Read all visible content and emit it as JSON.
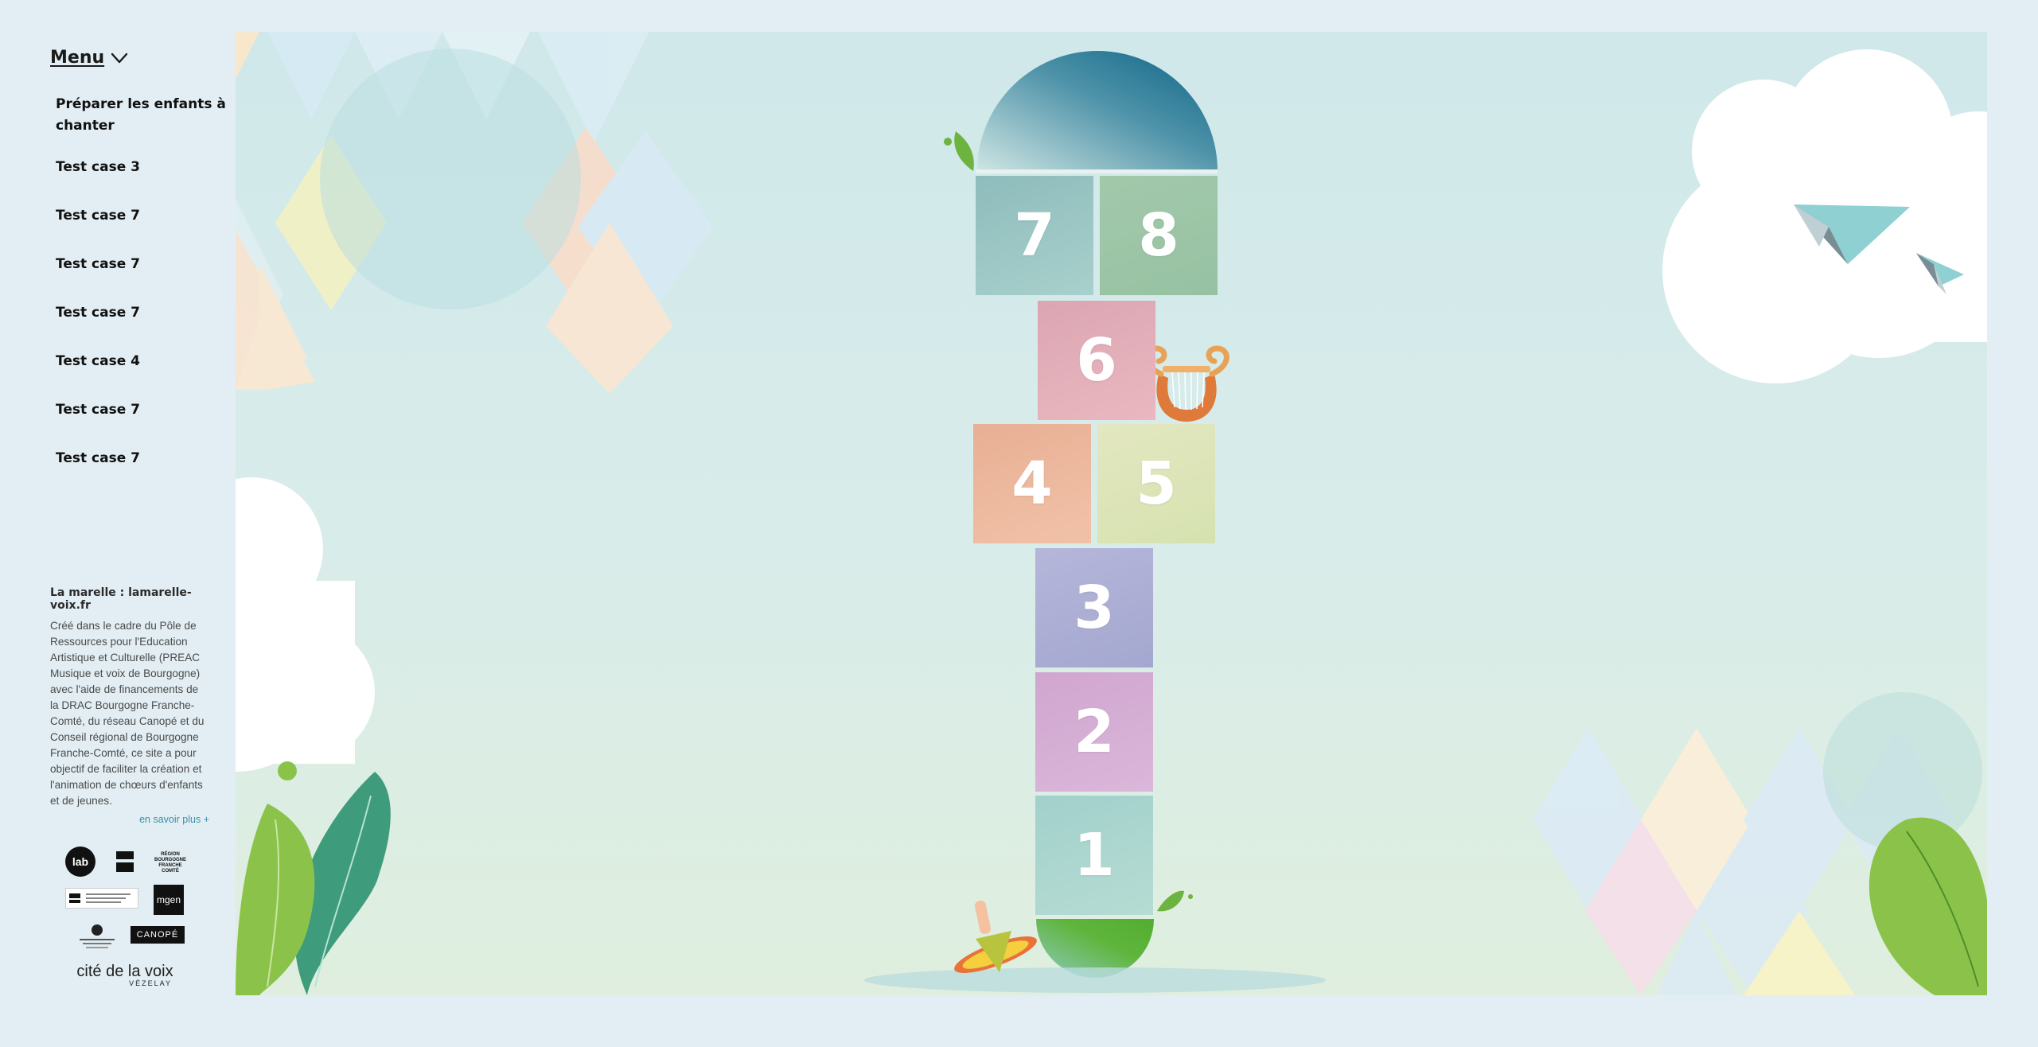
{
  "menu": {
    "toggle_label": "Menu",
    "items": [
      "Préparer les enfants à chanter",
      "Test case 3",
      "Test case 7",
      "Test case 7",
      "Test case 7",
      "Test case 4",
      "Test case 7",
      "Test case 7"
    ]
  },
  "about": {
    "title": "La marelle : lamarelle-voix.fr",
    "text": "Créé dans le cadre du Pôle de Ressources pour l'Education Artistique et Culturelle (PREAC Musique et voix de Bourgogne) avec l'aide de financements de la DRAC Bourgogne Franche-Comté, du réseau Canopé et du Conseil régional de Bourgogne Franche-Comté, ce site a pour objectif de faciliter la création et l'animation de chœurs d'enfants et de jeunes.",
    "more_link": "en savoir plus +"
  },
  "logos": {
    "lab": "lab",
    "mgen": "mgen",
    "canope": "CANOPÉ",
    "region": "RÉGION BOURGOGNE FRANCHE COMTÉ",
    "cite_title": "cité de la voix",
    "cite_sub": "VÉZELAY"
  },
  "hopscotch": {
    "squares": [
      "7",
      "8",
      "6",
      "4",
      "5",
      "3",
      "2",
      "1"
    ]
  },
  "colors": {
    "page_background": "#e2eef3",
    "sky_top": "#d0e8ea",
    "dome": "#0f6a8a",
    "leaf_green": "#8bc34a",
    "leaf_dark": "#3e9b7c",
    "link": "#3b93a8"
  },
  "icons": [
    "chevron-down-icon",
    "lyre-icon",
    "spinning-top-icon",
    "paper-plane-icon",
    "leaf-icon",
    "cloud-icon"
  ]
}
